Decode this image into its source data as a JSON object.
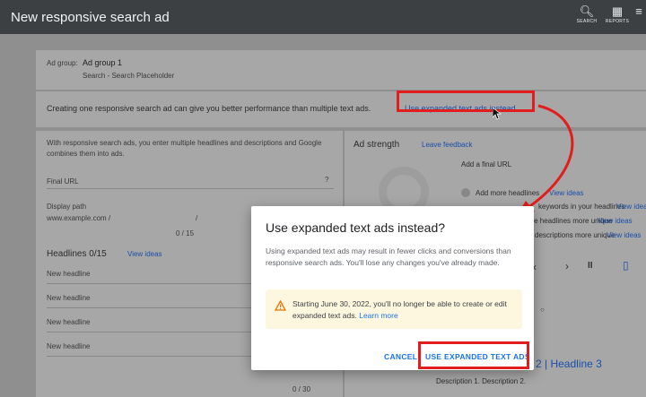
{
  "header": {
    "title": "New responsive search ad",
    "search_label": "SEARCH",
    "reports_label": "REPORTS"
  },
  "adgroup": {
    "label": "Ad group:",
    "name": "Ad group 1",
    "campaign": "Search - Search Placeholder"
  },
  "banner": {
    "text": "Creating one responsive search ad can give you better performance than multiple text ads.",
    "link": "Use expanded text ads instead"
  },
  "form": {
    "intro": "With responsive search ads, you enter multiple headlines and descriptions and Google combines them into ads.",
    "final_url_placeholder": "Final URL",
    "display_path_label": "Display path",
    "display_path_domain": "www.example.com /",
    "display_path_sep": "/",
    "path_counter": "0 / 15",
    "headlines_title": "Headlines 0/15",
    "view_ideas": "View ideas",
    "headline_placeholder": "New headline",
    "headline_counter": "0 / 30"
  },
  "strength": {
    "title": "Ad strength",
    "feedback": "Leave feedback",
    "final_url": "Add a final URL",
    "items": [
      {
        "text": "Add more headlines",
        "link": "View ideas"
      },
      {
        "text": "keywords in your headlines",
        "link": "View ideas"
      },
      {
        "text": "Make headlines more unique",
        "link": "View ideas"
      },
      {
        "text": "descriptions more unique",
        "link": "View ideas"
      }
    ]
  },
  "preview": {
    "headline": "2 | Headline 3",
    "description": "Description 1. Description 2."
  },
  "dialog": {
    "title": "Use expanded text ads instead?",
    "body": "Using expanded text ads may result in fewer clicks and conversions than responsive search ads. You'll lose any changes you've already made.",
    "warning": "Starting June 30, 2022, you'll no longer be able to create or edit expanded text ads.",
    "warning_link": "Learn more",
    "cancel": "CANCEL",
    "confirm": "USE EXPANDED TEXT ADS"
  },
  "colors": {
    "highlight": "#e21d1d",
    "link": "#1a73e8"
  }
}
